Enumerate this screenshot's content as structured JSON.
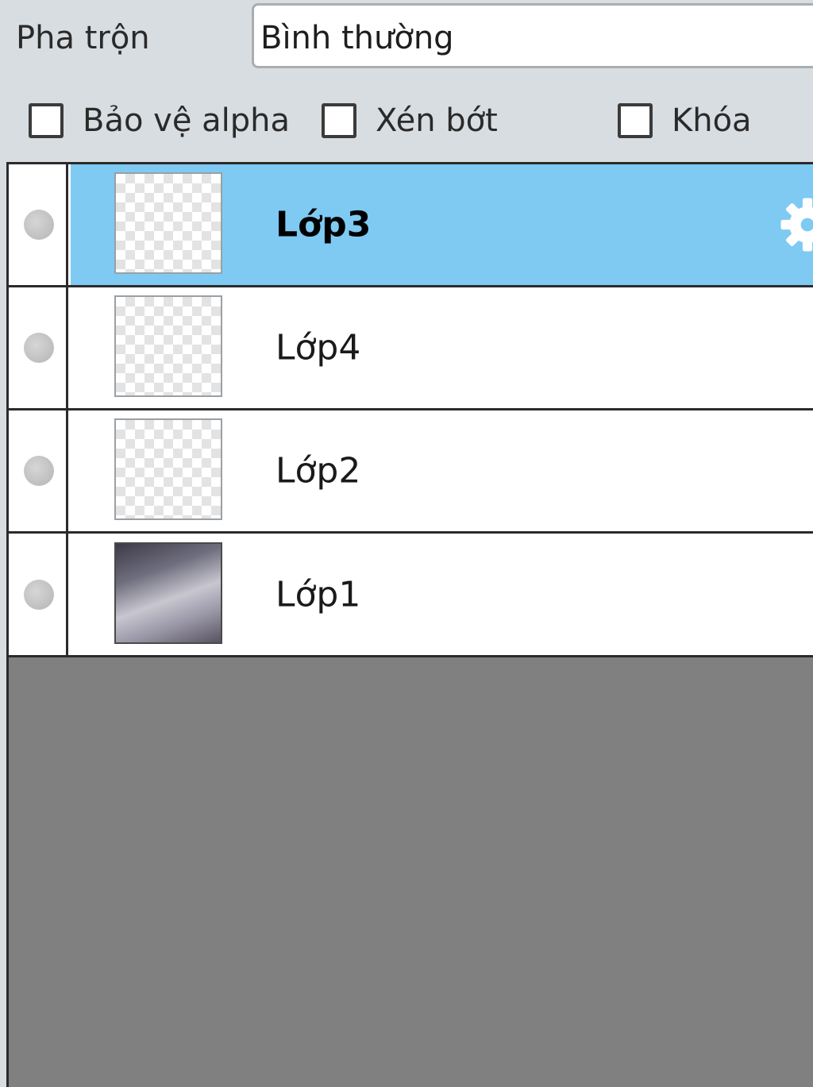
{
  "blend": {
    "label": "Pha trộn",
    "value": "Bình thường"
  },
  "options": [
    {
      "label": "Bảo vệ alpha",
      "checked": false
    },
    {
      "label": "Xén bớt",
      "checked": false
    },
    {
      "label": "Khóa",
      "checked": false
    }
  ],
  "layers": [
    {
      "name": "Lớp3",
      "selected": true,
      "visible": false
    },
    {
      "name": "Lớp4",
      "selected": false,
      "visible": false
    },
    {
      "name": "Lớp2",
      "selected": false,
      "visible": false
    },
    {
      "name": "Lớp1",
      "selected": false,
      "visible": false
    }
  ],
  "colors": {
    "selected_row": "#7ecaf3",
    "panel_bg": "#d8dde1",
    "empty_list_bg": "#808080"
  },
  "icons": {
    "visibility": "visibility-dot-icon",
    "settings": "gear-icon"
  }
}
